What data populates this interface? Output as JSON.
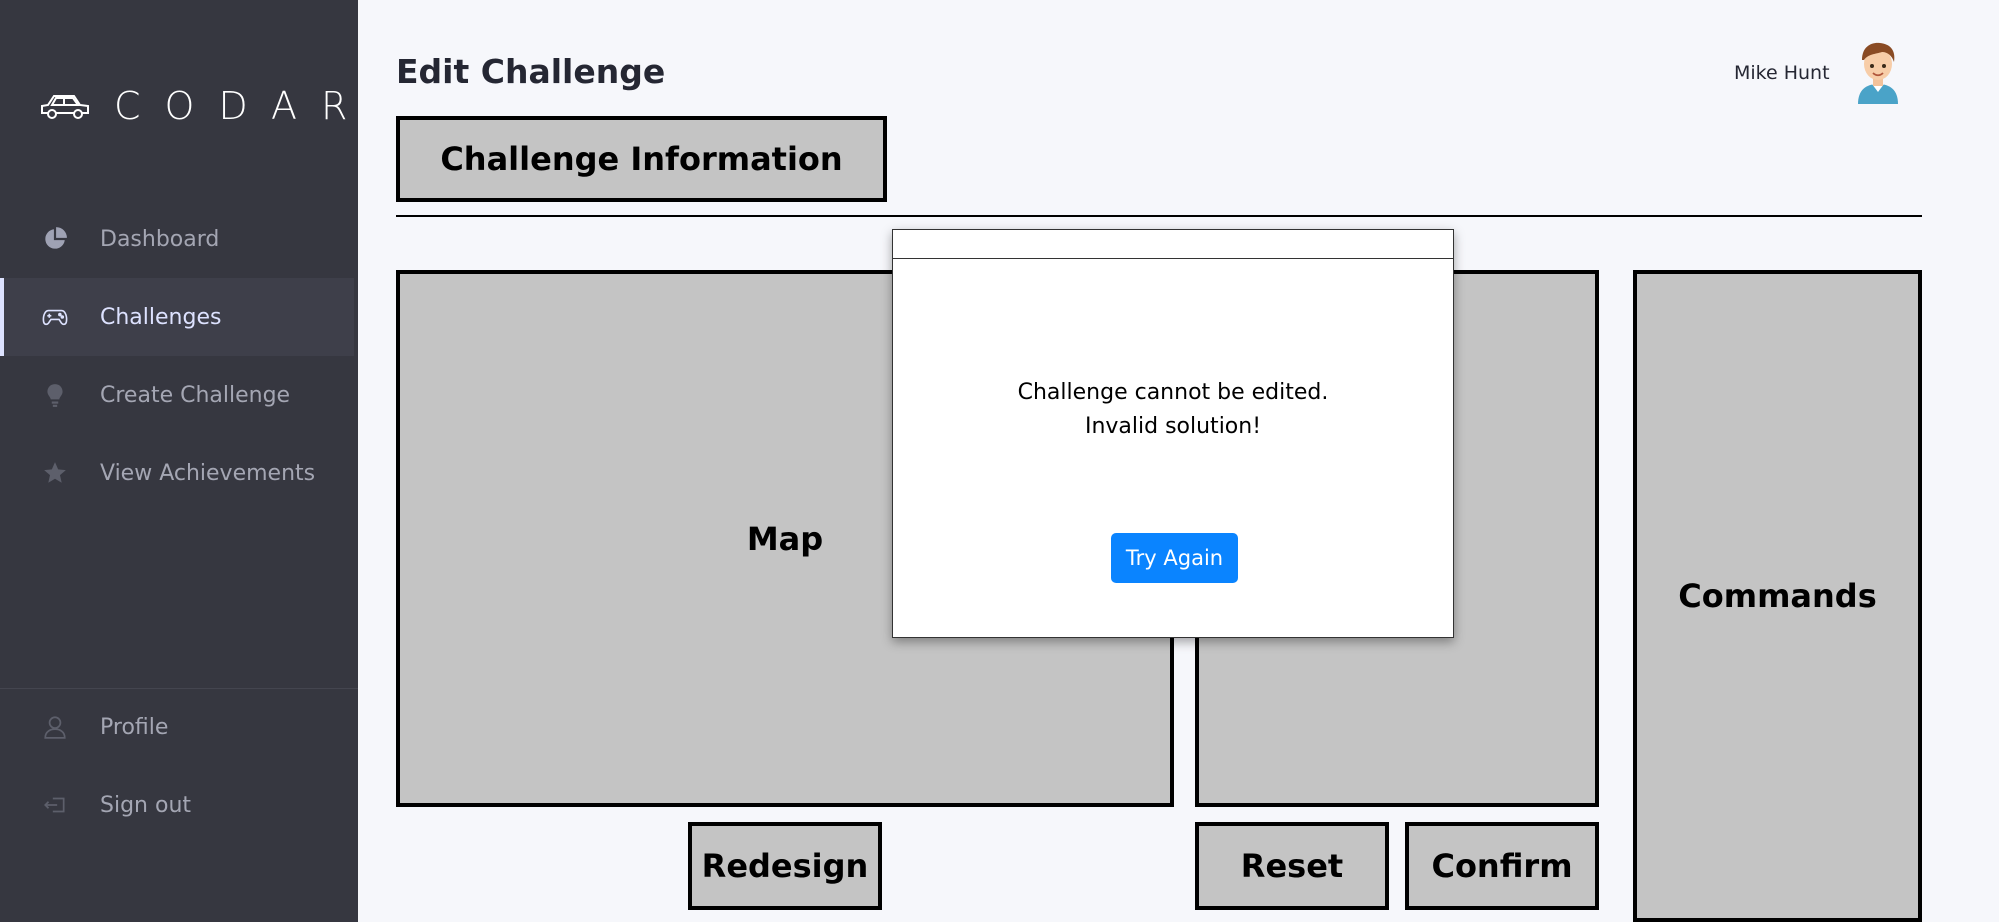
{
  "sidebar": {
    "logo_text": "CODAR",
    "items": [
      {
        "label": "Dashboard",
        "icon": "pie-chart-icon"
      },
      {
        "label": "Challenges",
        "icon": "gamepad-icon",
        "active": true
      },
      {
        "label": "Create Challenge",
        "icon": "lightbulb-icon"
      },
      {
        "label": "View Achievements",
        "icon": "star-icon"
      }
    ],
    "bottom_items": [
      {
        "label": "Profile",
        "icon": "user-icon"
      },
      {
        "label": "Sign out",
        "icon": "sign-out-icon"
      }
    ]
  },
  "header": {
    "title": "Edit Challenge",
    "user_name": "Mike Hunt"
  },
  "main": {
    "tab_label": "Challenge Information",
    "map_label": "Map",
    "commands_label": "Commands",
    "redesign_label": "Redesign",
    "reset_label": "Reset",
    "confirm_label": "Confirm"
  },
  "modal": {
    "message_line1": "Challenge cannot be edited.",
    "message_line2": "Invalid solution!",
    "button_label": "Try Again"
  },
  "colors": {
    "sidebar_bg": "#363740",
    "accent": "#0a84ff",
    "box_fill": "#c4c4c4"
  }
}
